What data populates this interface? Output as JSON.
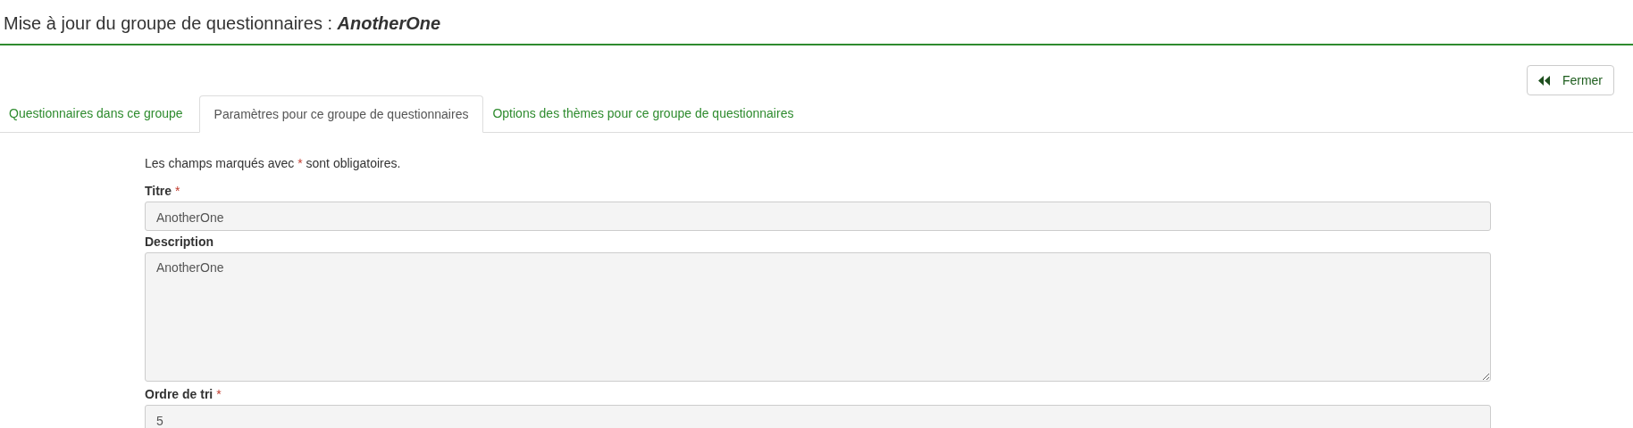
{
  "header": {
    "title": "Mise à jour du groupe de questionnaires :",
    "group_name": "AnotherOne"
  },
  "close_button": {
    "label": "Fermer"
  },
  "tabs": [
    {
      "label": "Questionnaires dans ce groupe",
      "selected": false
    },
    {
      "label": "Paramètres pour ce groupe de questionnaires",
      "selected": true
    },
    {
      "label": "Options des thèmes pour ce groupe de questionnaires",
      "selected": false
    }
  ],
  "form": {
    "note": {
      "before": "Les champs marqués avec",
      "mark": "*",
      "after": "sont obligatoires."
    },
    "fields": [
      {
        "label": "Titre",
        "required": true,
        "kind": "input",
        "value": "AnotherOne"
      },
      {
        "label": "Description",
        "required": false,
        "kind": "textarea",
        "value": "AnotherOne"
      },
      {
        "label": "Ordre de tri",
        "required": true,
        "kind": "input",
        "value": "5"
      }
    ]
  }
}
